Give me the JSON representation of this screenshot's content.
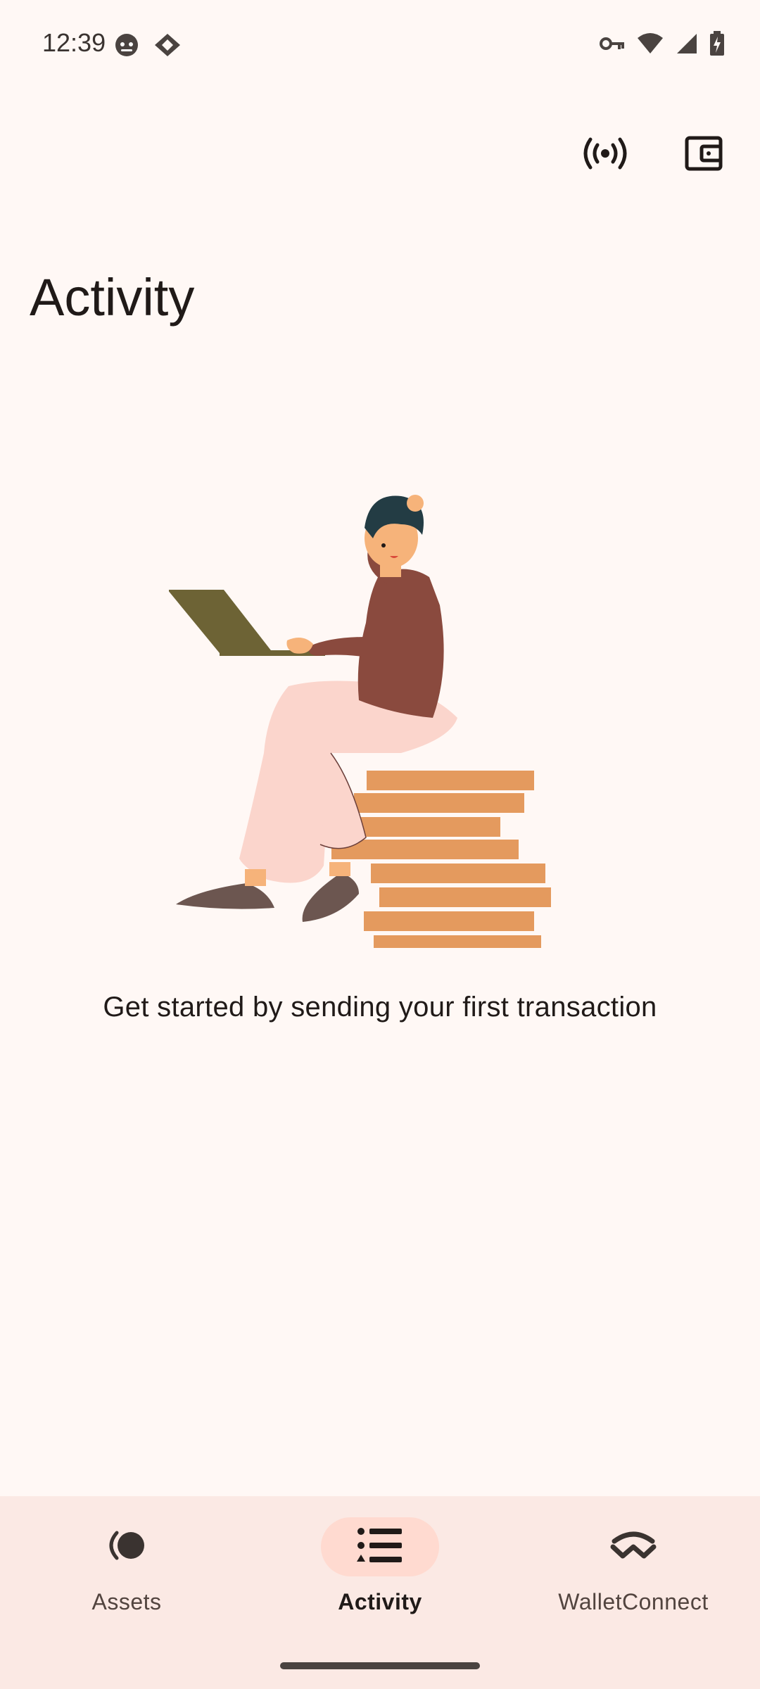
{
  "status_bar": {
    "time": "12:39",
    "left_icons": [
      "face-icon",
      "diamond-icon"
    ],
    "right_icons": [
      "vpn-key-icon",
      "wifi-icon",
      "signal-icon",
      "battery-charging-icon"
    ]
  },
  "app_bar": {
    "actions": [
      "broadcast-icon",
      "wallet-icon"
    ]
  },
  "page": {
    "title": "Activity",
    "empty_message": "Get started by sending your first transaction"
  },
  "bottom_nav": {
    "items": [
      {
        "label": "Assets",
        "icon": "assets-icon",
        "active": false
      },
      {
        "label": "Activity",
        "icon": "list-icon",
        "active": true
      },
      {
        "label": "WalletConnect",
        "icon": "walletconnect-icon",
        "active": false
      }
    ]
  },
  "colors": {
    "background": "#fff8f5",
    "nav_background": "#fbe9e4",
    "active_pill": "#ffdad0",
    "text": "#201a18"
  }
}
